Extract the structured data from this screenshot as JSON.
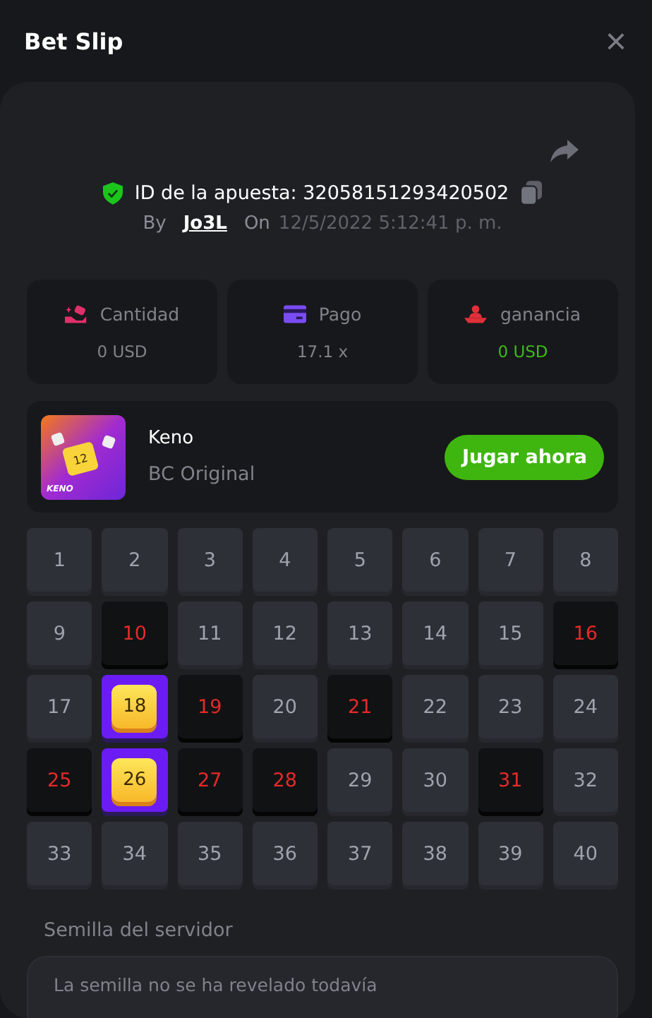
{
  "header": {
    "title": "Bet Slip",
    "close": "×"
  },
  "bet": {
    "id_label": "ID de la apuesta: 32058151293420502",
    "by_label": "By",
    "user": "Jo3L",
    "on_label": "On",
    "date": "12/5/2022 5:12:41 p. m."
  },
  "stats": [
    {
      "kind": "amount",
      "label": "Cantidad",
      "value": "0 USD",
      "win": false
    },
    {
      "kind": "payout",
      "label": "Pago",
      "value": "17.1 x",
      "win": false
    },
    {
      "kind": "profit",
      "label": "ganancia",
      "value": "0 USD",
      "win": true
    }
  ],
  "game": {
    "name": "Keno",
    "provider": "BC Original",
    "button": "Jugar ahora",
    "thumb_label": "KENO",
    "thumb_number": "12"
  },
  "cells": [
    {
      "n": "1",
      "kind": "plain"
    },
    {
      "n": "2",
      "kind": "plain"
    },
    {
      "n": "3",
      "kind": "plain"
    },
    {
      "n": "4",
      "kind": "plain"
    },
    {
      "n": "5",
      "kind": "plain"
    },
    {
      "n": "6",
      "kind": "plain"
    },
    {
      "n": "7",
      "kind": "plain"
    },
    {
      "n": "8",
      "kind": "plain"
    },
    {
      "n": "9",
      "kind": "plain"
    },
    {
      "n": "10",
      "kind": "drawn"
    },
    {
      "n": "11",
      "kind": "plain"
    },
    {
      "n": "12",
      "kind": "plain"
    },
    {
      "n": "13",
      "kind": "plain"
    },
    {
      "n": "14",
      "kind": "plain"
    },
    {
      "n": "15",
      "kind": "plain"
    },
    {
      "n": "16",
      "kind": "drawn"
    },
    {
      "n": "17",
      "kind": "plain"
    },
    {
      "n": "18",
      "kind": "hit"
    },
    {
      "n": "19",
      "kind": "drawn"
    },
    {
      "n": "20",
      "kind": "plain"
    },
    {
      "n": "21",
      "kind": "drawn"
    },
    {
      "n": "22",
      "kind": "plain"
    },
    {
      "n": "23",
      "kind": "plain"
    },
    {
      "n": "24",
      "kind": "plain"
    },
    {
      "n": "25",
      "kind": "drawn"
    },
    {
      "n": "26",
      "kind": "hit"
    },
    {
      "n": "27",
      "kind": "drawn"
    },
    {
      "n": "28",
      "kind": "drawn"
    },
    {
      "n": "29",
      "kind": "plain"
    },
    {
      "n": "30",
      "kind": "plain"
    },
    {
      "n": "31",
      "kind": "drawn"
    },
    {
      "n": "32",
      "kind": "plain"
    },
    {
      "n": "33",
      "kind": "plain"
    },
    {
      "n": "34",
      "kind": "plain"
    },
    {
      "n": "35",
      "kind": "plain"
    },
    {
      "n": "36",
      "kind": "plain"
    },
    {
      "n": "37",
      "kind": "plain"
    },
    {
      "n": "38",
      "kind": "plain"
    },
    {
      "n": "39",
      "kind": "plain"
    },
    {
      "n": "40",
      "kind": "plain"
    }
  ],
  "seed": {
    "label": "Semilla del servidor",
    "value": "La semilla no se ha revelado todavía"
  }
}
